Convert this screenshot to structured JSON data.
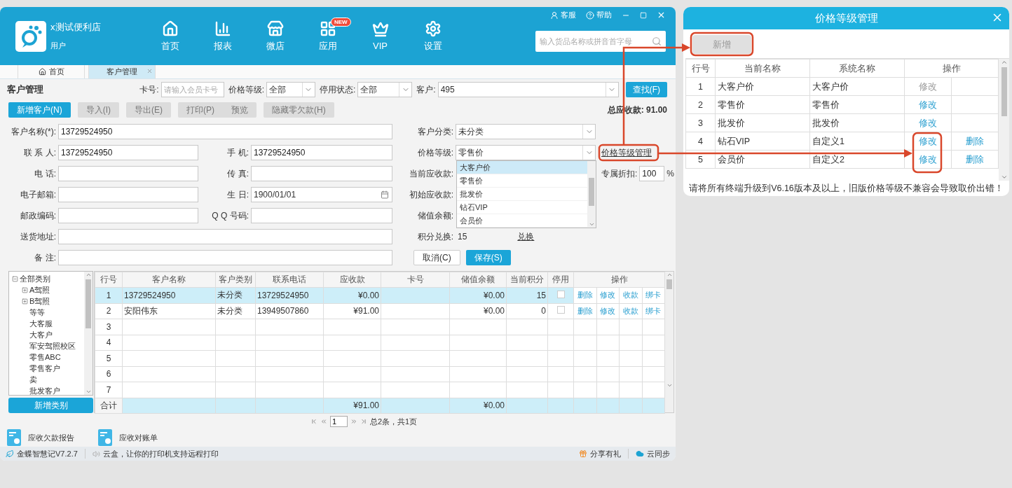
{
  "header": {
    "store_name": "x测试便利店",
    "user": "用户",
    "nav": [
      {
        "label": "首页"
      },
      {
        "label": "报表"
      },
      {
        "label": "微店"
      },
      {
        "label": "应用",
        "badge": "NEW"
      },
      {
        "label": "VIP"
      },
      {
        "label": "设置"
      }
    ],
    "top_links": [
      "客服",
      "帮助"
    ],
    "search": {
      "placeholder": "输入货品名称或拼音首字母"
    }
  },
  "tabs": [
    {
      "label": "首页",
      "selected": false,
      "closable": false
    },
    {
      "label": "客户管理",
      "selected": true,
      "closable": true
    }
  ],
  "page_title": "客户管理",
  "filters": [
    {
      "label": "卡号:",
      "kind": "input",
      "placeholder": "请输入会员卡号"
    },
    {
      "label": "价格等级:",
      "kind": "select",
      "value": "全部"
    },
    {
      "label": "停用状态:",
      "kind": "select",
      "value": "全部"
    },
    {
      "label": "客户:",
      "kind": "select",
      "value": "495"
    }
  ],
  "search_button": "查找(F)",
  "toolbar": [
    {
      "label": "新增客户(N)",
      "kind": "primary"
    },
    {
      "label": "导入(I)",
      "kind": "default"
    },
    {
      "label": "导出(E)",
      "kind": "default"
    },
    {
      "label": "打印(P)",
      "kind": "group-start"
    },
    {
      "label": "预览",
      "kind": "group-end"
    },
    {
      "label": "隐藏零欠款(H)",
      "kind": "default"
    }
  ],
  "total": {
    "label": "总应收款:",
    "value": "91.00"
  },
  "form": {
    "rows": [
      {
        "cells": [
          {
            "kind": "wide-input",
            "label": "客户名称(*):",
            "value": "13729524950"
          },
          {
            "kind": "select",
            "label": "客户分类:",
            "value": "未分类"
          }
        ]
      },
      {
        "cells": [
          {
            "kind": "input",
            "label": "联 系 人:",
            "value": "13729524950"
          },
          {
            "kind": "input",
            "label": "手 机:",
            "value": "13729524950"
          },
          {
            "kind": "select",
            "label": "价格等级:",
            "value": "零售价",
            "open": true,
            "options": [
              {
                "label": "大客户价",
                "highlighted": true
              },
              {
                "label": "零售价",
                "highlighted": false
              },
              {
                "label": "批发价",
                "highlighted": false
              },
              {
                "label": "钻石VIP",
                "highlighted": false
              },
              {
                "label": "会员价",
                "highlighted": false
              }
            ]
          }
        ],
        "extra": {
          "kind": "link",
          "label": "价格等级管理"
        }
      },
      {
        "cells": [
          {
            "kind": "input",
            "label": "电 话:"
          },
          {
            "kind": "input",
            "label": "传 真:"
          },
          {
            "kind": "label",
            "label": "当前应收款:"
          }
        ],
        "extra": {
          "kind": "discount",
          "label": "专属折扣:",
          "value": "100",
          "unit": "%"
        }
      },
      {
        "cells": [
          {
            "kind": "input",
            "label": "电子邮箱:"
          },
          {
            "kind": "date",
            "label": "生 日:",
            "value": "1900/01/01"
          },
          {
            "kind": "label",
            "label": "初始应收款:"
          }
        ]
      },
      {
        "cells": [
          {
            "kind": "input",
            "label": "邮政编码:"
          },
          {
            "kind": "input",
            "label": "Q Q 号码:"
          },
          {
            "kind": "label",
            "label": "储值余额:"
          }
        ]
      },
      {
        "cells": [
          {
            "kind": "wide-input",
            "label": "送货地址:"
          },
          {
            "kind": "text",
            "label": "积分兑换:",
            "value": "15",
            "link": "兑换"
          }
        ]
      },
      {
        "cells": [
          {
            "kind": "wide-input",
            "label": "备 注:"
          },
          {
            "kind": "buttons",
            "buttons": [
              {
                "label": "取消(C)",
                "kind": "default"
              },
              {
                "label": "保存(S)",
                "kind": "primary"
              }
            ]
          }
        ]
      }
    ]
  },
  "tree": {
    "label": "全部类别",
    "expanded": true,
    "children": [
      {
        "label": "A驾照",
        "expanded": false
      },
      {
        "label": "B驾照",
        "expanded": false
      },
      {
        "label": "等等"
      },
      {
        "label": "大客服"
      },
      {
        "label": "大客户"
      },
      {
        "label": "军安驾照校区"
      },
      {
        "label": "零售ABC"
      },
      {
        "label": "零售客户"
      },
      {
        "label": "卖"
      },
      {
        "label": "批发客户"
      }
    ]
  },
  "new_category_button": "新增类别",
  "grid": {
    "columns": [
      "行号",
      "客户名称",
      "客户类别",
      "联系电话",
      "应收款",
      "卡号",
      "储值余额",
      "当前积分",
      "停用",
      "操作"
    ],
    "rows": [
      {
        "no": "1",
        "name": "13729524950",
        "category": "未分类",
        "phone": "13729524950",
        "receivable": "¥0.00",
        "balance": "¥0.00",
        "points": "15",
        "stopped": false,
        "actions": [
          "删除",
          "修改",
          "收款",
          "绑卡"
        ],
        "selected": true
      },
      {
        "no": "2",
        "name": "安阳伟东",
        "category": "未分类",
        "phone": "13949507860",
        "receivable": "¥91.00",
        "balance": "¥0.00",
        "points": "0",
        "stopped": false,
        "actions": [
          "删除",
          "修改",
          "收款",
          "绑卡"
        ],
        "selected": false
      },
      {
        "no": "3",
        "selected": false
      },
      {
        "no": "4",
        "selected": false
      },
      {
        "no": "5",
        "selected": false
      },
      {
        "no": "6",
        "selected": false
      },
      {
        "no": "7",
        "selected": false
      }
    ],
    "total": {
      "label": "合计",
      "receivable": "¥91.00",
      "balance": "¥0.00"
    }
  },
  "pagination": {
    "page": "1",
    "summary": "总2条，共1页"
  },
  "reports": [
    "应收欠款报告",
    "应收对账单"
  ],
  "status_bar": {
    "version": "金蝶智慧记V7.2.7",
    "message": "云盒，让你的打印机支持远程打印",
    "links": [
      "分享有礼",
      "云同步"
    ]
  },
  "dialog": {
    "title": "价格等级管理",
    "add_button": {
      "label": "新增",
      "disabled": true
    },
    "columns": [
      "行号",
      "当前名称",
      "系统名称",
      "操作"
    ],
    "rows": [
      {
        "no": "1",
        "name": "大客户价",
        "system_name": "大客户价",
        "edit": {
          "label": "修改",
          "disabled": true
        }
      },
      {
        "no": "2",
        "name": "零售价",
        "system_name": "零售价",
        "edit": {
          "label": "修改",
          "disabled": false
        }
      },
      {
        "no": "3",
        "name": "批发价",
        "system_name": "批发价",
        "edit": {
          "label": "修改",
          "disabled": false
        }
      },
      {
        "no": "4",
        "name": "钻石VIP",
        "system_name": "自定义1",
        "edit": {
          "label": "修改",
          "disabled": false
        },
        "delete": "删除"
      },
      {
        "no": "5",
        "name": "会员价",
        "system_name": "自定义2",
        "edit": {
          "label": "修改",
          "disabled": false
        },
        "delete": "删除"
      }
    ],
    "notice": "请将所有终端升级到V6.16版本及以上，旧版价格等级不兼容会导致取价出错！"
  }
}
